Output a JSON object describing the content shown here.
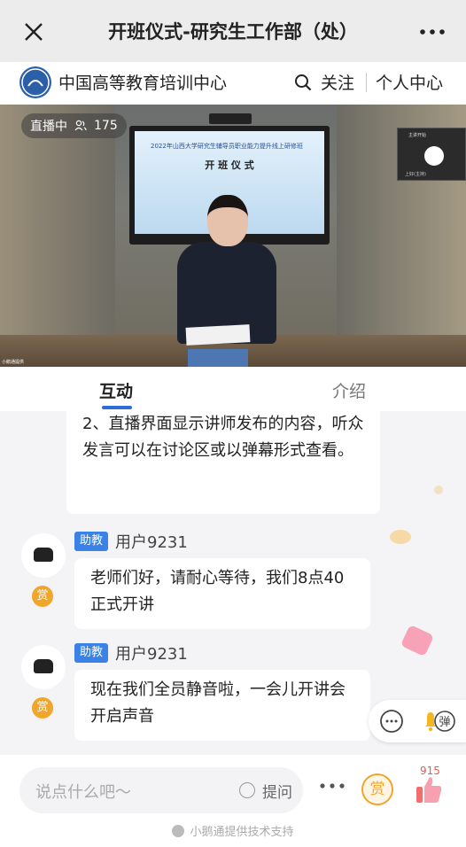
{
  "header": {
    "title": "开班仪式-研究生工作部（处）"
  },
  "org": {
    "name": "中国高等教育培训中心",
    "follow_label": "关注",
    "profile_label": "个人中心"
  },
  "live": {
    "status_label": "直播中",
    "viewer_count": "175",
    "screen_subtitle": "2022年山西大学研究生辅导员职业能力提升线上研修班",
    "screen_title": "开 班 仪 式",
    "pip_title": "主讲开始",
    "pip_label": "上好(主持)",
    "caption": "小鹅通提供"
  },
  "tabs": {
    "interact": "互动",
    "intro": "介绍"
  },
  "messages": [
    {
      "text": "2、直播界面显示讲师发布的内容，听众发言可以在讨论区或以弹幕形式查看。"
    },
    {
      "badge": "助教",
      "user": "用户9231",
      "reward": "赏",
      "text": "老师们好，请耐心等待，我们8点40正式开讲"
    },
    {
      "badge": "助教",
      "user": "用户9231",
      "reward": "赏",
      "text": "现在我们全员静音啦，一会儿开讲会开启声音"
    }
  ],
  "floatbar": {
    "danmu_label": "弹"
  },
  "bottom": {
    "comment_placeholder": "说点什么吧～",
    "ask_label": "提问",
    "reward_label": "赏",
    "like_count": "915",
    "footer": "小鹅通提供技术支持"
  },
  "colors": {
    "accent": "#2c6bd8",
    "reward": "#f0a52b",
    "badge": "#3b82e6"
  }
}
